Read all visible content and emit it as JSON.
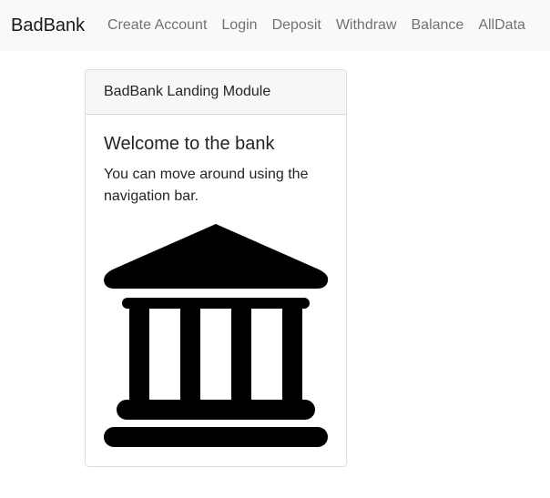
{
  "navbar": {
    "brand": "BadBank",
    "links": [
      "Create Account",
      "Login",
      "Deposit",
      "Withdraw",
      "Balance",
      "AllData"
    ]
  },
  "card": {
    "header": "BadBank Landing Module",
    "title": "Welcome to the bank",
    "text": "You can move around using the navigation bar.",
    "image_icon": "bank-building-icon"
  },
  "colors": {
    "navbar_background": "#f8f9fa",
    "card_header_background": "#f7f7f7",
    "nav_link": "#737373",
    "text": "#212529"
  }
}
